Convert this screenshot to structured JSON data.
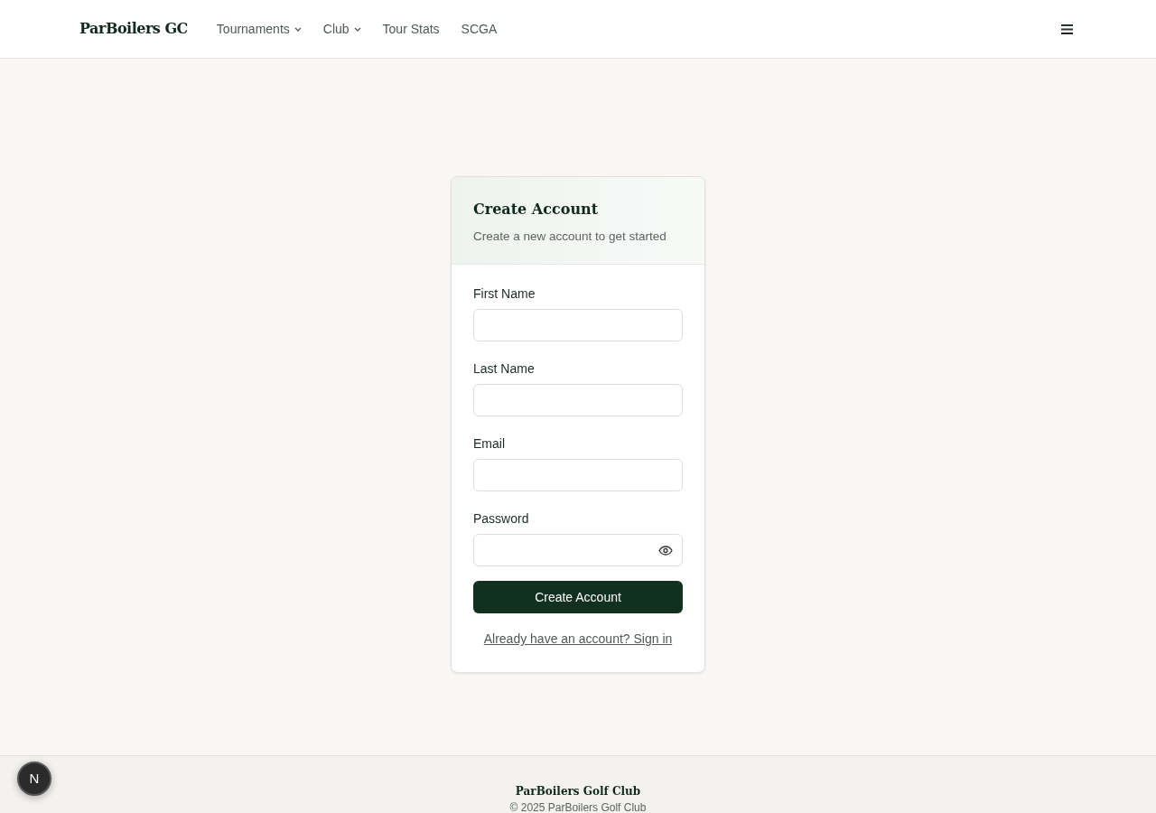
{
  "navbar": {
    "brand": "ParBoilers GC",
    "items": [
      {
        "label": "Tournaments",
        "kind": "dropdown"
      },
      {
        "label": "Club",
        "kind": "dropdown"
      },
      {
        "label": "Tour Stats",
        "kind": "link"
      },
      {
        "label": "SCGA",
        "kind": "link"
      }
    ]
  },
  "card": {
    "title": "Create Account",
    "subtitle": "Create a new account to get started",
    "fields": [
      {
        "label": "First Name",
        "kind": "text"
      },
      {
        "label": "Last Name",
        "kind": "text"
      },
      {
        "label": "Email",
        "kind": "email"
      },
      {
        "label": "Password",
        "kind": "password"
      }
    ],
    "submit": "Create Account",
    "signin_link": "Already have an account? Sign in"
  },
  "dev_badge": "N",
  "footer": {
    "title": "ParBoilers Golf Club",
    "copyright": "© 2025 ParBoilers Golf Club"
  }
}
